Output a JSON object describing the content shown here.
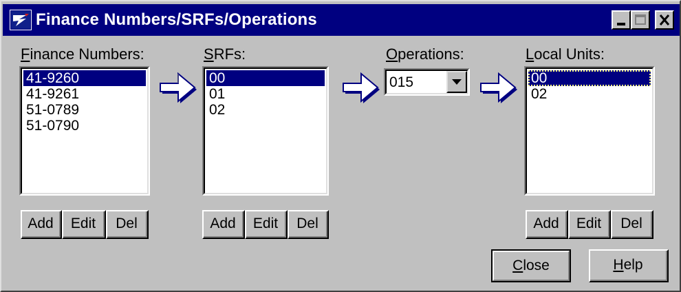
{
  "window": {
    "title": "Finance Numbers/SRFs/Operations",
    "controls": [
      "minimize-icon",
      "maximize-icon",
      "close-icon"
    ]
  },
  "finance": {
    "label_mnemonic": "F",
    "label_rest": "inance Numbers:",
    "items": [
      "41-9260",
      "41-9261",
      "51-0789",
      "51-0790"
    ],
    "selected_index": 0,
    "add": "Add",
    "edit": "Edit",
    "del": "Del"
  },
  "srfs": {
    "label_mnemonic": "S",
    "label_rest": "RFs:",
    "items": [
      "00",
      "01",
      "02"
    ],
    "selected_index": 0,
    "add": "Add",
    "edit": "Edit",
    "del": "Del"
  },
  "operations": {
    "label_mnemonic": "O",
    "label_rest": "perations:",
    "value": "015"
  },
  "local_units": {
    "label_mnemonic": "L",
    "label_rest": "ocal Units:",
    "items": [
      "00",
      "02"
    ],
    "selected_index": 0,
    "add": "Add",
    "edit": "Edit",
    "del": "Del"
  },
  "footer": {
    "close_mnemonic": "C",
    "close_rest": "lose",
    "help_mnemonic": "H",
    "help_rest": "elp"
  },
  "icons": {
    "app": "eagle-logo-icon",
    "arrow": "right-arrow-icon",
    "dropdown": "chevron-down-icon"
  },
  "colors": {
    "titlebar": "#000080",
    "face": "#c0c0c0",
    "selection": "#000080",
    "arrow_fill": "#ffffff",
    "arrow_outline": "#000080"
  }
}
